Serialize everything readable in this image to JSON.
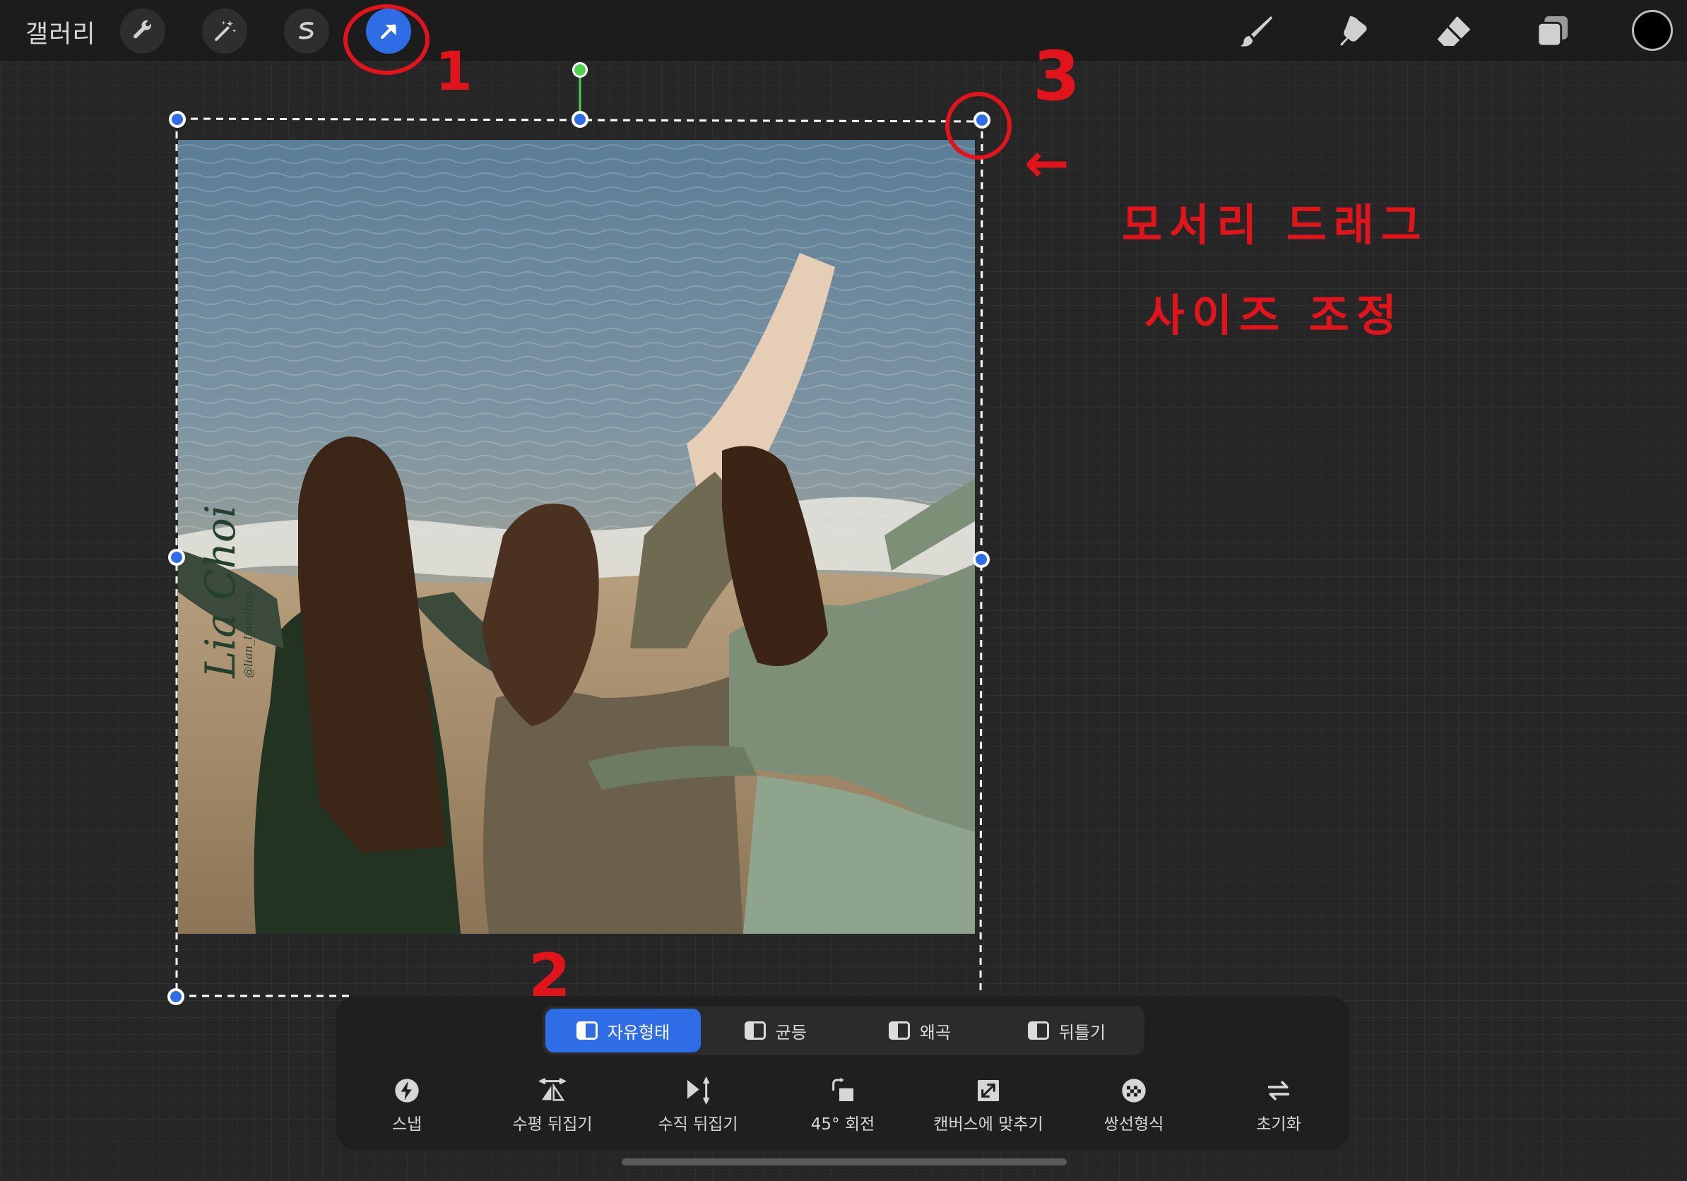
{
  "topbar": {
    "gallery_label": "갤러리",
    "tools": [
      {
        "name": "actions",
        "icon": "wrench-icon"
      },
      {
        "name": "adjustments",
        "icon": "magic-wand-icon"
      },
      {
        "name": "selection",
        "icon": "selection-s-icon"
      },
      {
        "name": "transform",
        "icon": "arrow-cursor-icon",
        "active": true
      }
    ],
    "right_tools": [
      "brush-icon",
      "smudge-icon",
      "eraser-icon",
      "layers-icon"
    ],
    "current_color": "#000000"
  },
  "artwork": {
    "signature_name": "Lia Choi",
    "signature_handle": "@lian_lineillust"
  },
  "annotations": {
    "mark_1": "1",
    "mark_2": "2",
    "mark_3": "3",
    "note_line1": "모서리 드래그",
    "note_line2": "사이즈 조정"
  },
  "transform_modes": [
    {
      "label": "자유형태",
      "active": true
    },
    {
      "label": "균등",
      "active": false
    },
    {
      "label": "왜곡",
      "active": false
    },
    {
      "label": "뒤틀기",
      "active": false
    }
  ],
  "actions": [
    {
      "label": "스냅",
      "icon": "lightning-icon"
    },
    {
      "label": "수평 뒤집기",
      "icon": "flip-horizontal-icon"
    },
    {
      "label": "수직 뒤집기",
      "icon": "flip-vertical-icon"
    },
    {
      "label": "45° 회전",
      "icon": "rotate-45-icon"
    },
    {
      "label": "캔버스에 맞추기",
      "icon": "fit-canvas-icon"
    },
    {
      "label": "쌍선형식",
      "icon": "bilinear-icon"
    },
    {
      "label": "초기화",
      "icon": "reset-icon"
    }
  ],
  "colors": {
    "accent": "#2f6de6",
    "annotation": "#e1141c",
    "handle": "#2f6de6",
    "rotate_handle": "#4cd14c"
  }
}
